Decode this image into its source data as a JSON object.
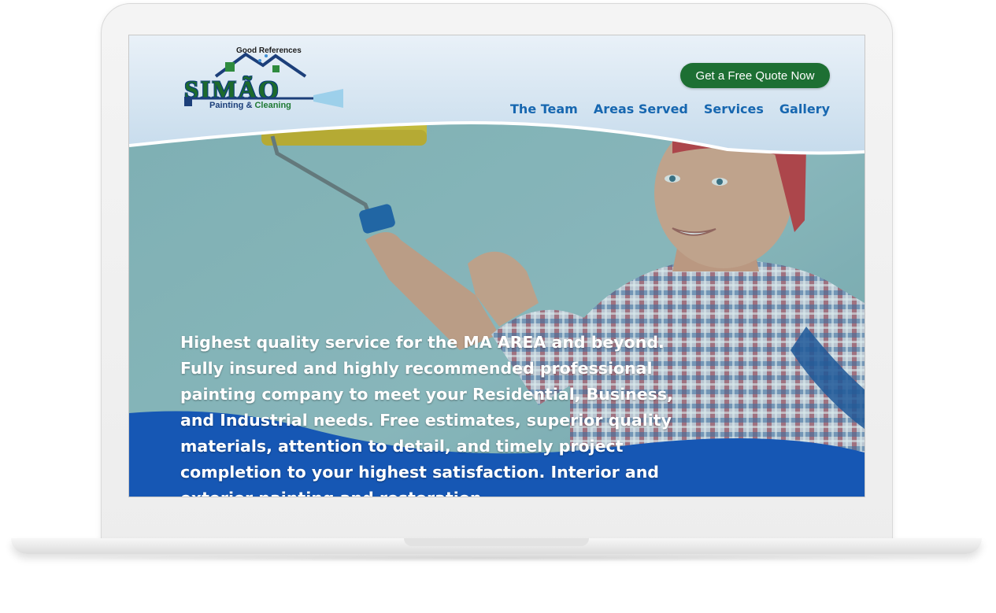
{
  "logo": {
    "tagline": "Good References",
    "name": "SIMÃO",
    "sub_part1": "Painting & ",
    "sub_part2": "Cleaning"
  },
  "header": {
    "cta_label": "Get a Free Quote Now",
    "nav": [
      "The Team",
      "Areas Served",
      "Services",
      "Gallery"
    ]
  },
  "hero": {
    "text": "Highest quality service for the MA AREA and beyond. Fully insured and highly recommended professional painting company to meet your Residential, Business, and Industrial needs. Free estimates, superior quality materials, attention to detail, and timely project completion to your highest satisfaction. Interior and exterior painting and restoration."
  },
  "colors": {
    "brand_green": "#1d6f33",
    "nav_blue": "#1767b0",
    "wave_blue": "#1657b4"
  },
  "icons": [
    "house-roof-icon",
    "pressure-washer-icon"
  ]
}
